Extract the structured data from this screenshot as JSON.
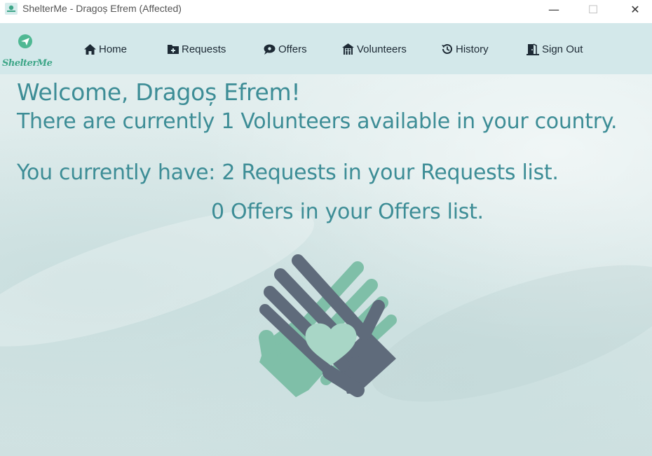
{
  "window": {
    "title": "ShelterMe - Dragoș Efrem (Affected)",
    "minimize_glyph": "—",
    "maximize_glyph": "☐",
    "close_glyph": "✕"
  },
  "logo": {
    "text": "ShelterMe",
    "icon": "paper-plane-icon"
  },
  "nav": {
    "home": "Home",
    "requests": "Requests",
    "offers": "Offers",
    "volunteers": "Volunteers",
    "history": "History",
    "sign_out": "Sign Out"
  },
  "main": {
    "welcome": "Welcome, Dragoș Efrem!",
    "volunteers_line": "There are currently 1 Volunteers available in your country.",
    "requests_line": "You currently have: 2 Requests in your Requests list.",
    "offers_line": "0 Offers in your Offers list."
  },
  "colors": {
    "accent_text": "#3d8d96",
    "navbar": "#d3e8ea",
    "hand_dark": "#5f6b7b",
    "hand_green": "#7fbfa8",
    "heart": "#a8d6c6",
    "logo_green": "#3ea688"
  }
}
